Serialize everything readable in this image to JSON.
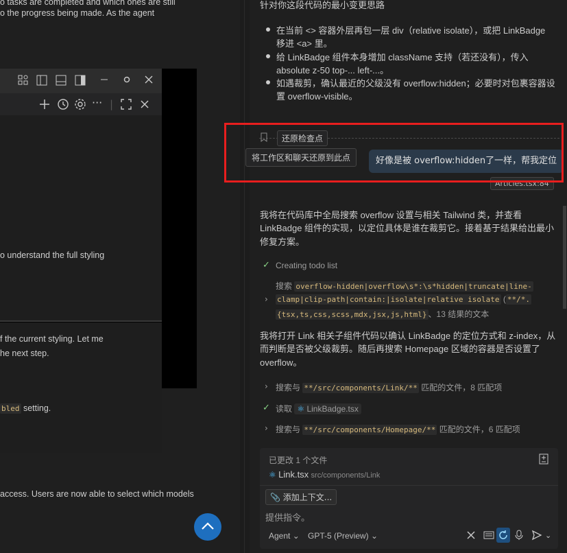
{
  "left_doc": {
    "line1": "o tasks are completed and which ones are still",
    "line2": "o the progress being made. As the agent",
    "line3": "o understand the full styling",
    "line4": "f the current styling. Let me",
    "line5": "he next step.",
    "line6_code": "bled",
    "line6_rest": " setting.",
    "line7": "access. Users are now able to select which models"
  },
  "chat": {
    "heading": "针对你这段代码的最小变更思路",
    "bullets": [
      "在当前 <> 容器外层再包一层 div（relative isolate），或把 LinkBadge",
      "移进 <a> 里。",
      "给 LinkBadge 组件本身增加 className 支持（若还没有），传入",
      "absolute z-50 top-... left-...。",
      "如遇裁剪，确认最近的父级没有 overflow:hidden；必要时对包裹容器设",
      "置 overflow-visible。"
    ],
    "checkpoint_tooltip": "还原检查点",
    "restore_tooltip": "将工作区和聊天还原到此点",
    "user_message": "好像是被 overflow:hidden了一样，帮我定位",
    "attachment_label": "Articles.tsx:84",
    "reply_para1": [
      "我将在代码库中全局搜索 overflow 设置与相关 Tailwind 类，并查看",
      "LinkBadge 组件的实现，以定位具体是谁在裁剪它。接着基于结果给出最小",
      "修复方案。"
    ],
    "todo_label": "Creating todo list",
    "search1_prefix": "搜索 ",
    "search1_code": "overflow-hidden|overflow\\s*:\\s*hidden|truncate|line-",
    "search1_code2": "clamp|clip-path|contain:|isolate|relative isolate",
    "search1_glob": "**/*.",
    "search1_code3": "{tsx,ts,css,scss,mdx,jsx,js,html}",
    "search1_suffix": "、13 结果的文本",
    "reply_para2": [
      "我将打开 Link 相关子组件代码以确认 LinkBadge 的定位方式和 z-index，从",
      "而判断是否被父级裁剪。随后再搜索 Homepage 区域的容器是否设置了",
      "overflow。"
    ],
    "search2_prefix": "搜索与 ",
    "search2_code": "**/src/components/Link/**",
    "search2_suffix": " 匹配的文件，8 匹配项",
    "read_prefix": "读取 ",
    "read_file": "LinkBadge.tsx",
    "search3_prefix": "搜索与 ",
    "search3_code": "**/src/components/Homepage/**",
    "search3_suffix": " 匹配的文件，6 匹配项"
  },
  "panel": {
    "changed_label": "已更改 1 个文件",
    "file_name": "Link.tsx",
    "file_path": "src/components/Link",
    "add_context": "添加上下文...",
    "placeholder": "提供指令。",
    "mode": "Agent",
    "model": "GPT-5 (Preview)"
  },
  "colors": {
    "accent": "#1e6fbf",
    "highlight": "#e81e1e",
    "check": "#89d185"
  }
}
